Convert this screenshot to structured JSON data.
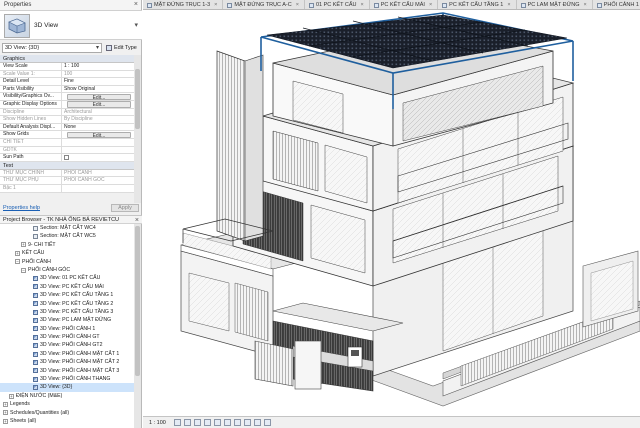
{
  "properties": {
    "title": "Properties",
    "type_selector": "3D View",
    "view_dropdown": "3D View: {3D}",
    "edit_type": "Edit Type",
    "sections": {
      "graphics": "Graphics",
      "text": "Text"
    },
    "graphics_rows": [
      {
        "key": "View Scale",
        "value": "1 : 100",
        "dim": false,
        "kind": "text"
      },
      {
        "key": "Scale Value    1:",
        "value": "100",
        "dim": true,
        "kind": "text"
      },
      {
        "key": "Detail Level",
        "value": "Fine",
        "dim": false,
        "kind": "text"
      },
      {
        "key": "Parts Visibility",
        "value": "Show Original",
        "dim": false,
        "kind": "text"
      },
      {
        "key": "Visibility/Graphics Ov...",
        "value": "Edit...",
        "dim": false,
        "kind": "button"
      },
      {
        "key": "Graphic Display Options",
        "value": "Edit...",
        "dim": false,
        "kind": "button"
      },
      {
        "key": "Discipline",
        "value": "Architectural",
        "dim": true,
        "kind": "text"
      },
      {
        "key": "Show Hidden Lines",
        "value": "By Discipline",
        "dim": true,
        "kind": "text"
      },
      {
        "key": "Default Analysis Displ...",
        "value": "None",
        "dim": false,
        "kind": "text"
      },
      {
        "key": "Show Grids",
        "value": "Edit...",
        "dim": false,
        "kind": "button"
      },
      {
        "key": "CHI TIẾT",
        "value": "",
        "dim": true,
        "kind": "text"
      },
      {
        "key": "GDTK",
        "value": "",
        "dim": true,
        "kind": "text"
      },
      {
        "key": "Sun Path",
        "value": "",
        "dim": false,
        "kind": "checkbox"
      }
    ],
    "text_rows": [
      {
        "key": "THƯ MỤC CHÍNH",
        "value": "PHỐI CẢNH",
        "dim": true
      },
      {
        "key": "THƯ MỤC PHỤ",
        "value": "PHỐI CẢNH GÓC",
        "dim": true
      },
      {
        "key": "Bậc 1",
        "value": "",
        "dim": true
      }
    ],
    "help_link": "Properties help",
    "apply": "Apply"
  },
  "project_browser": {
    "title": "Project Browser - TK NHÀ ỐNG BÁ REVIETCU",
    "items": [
      {
        "label": "Section: MẶT CẮT WC4",
        "indent": 5,
        "toggle": "",
        "icon": "view",
        "selected": false
      },
      {
        "label": "Section: MẶT CẮT WC5",
        "indent": 5,
        "toggle": "",
        "icon": "view",
        "selected": false
      },
      {
        "label": "9- CHI TIẾT",
        "indent": 3,
        "toggle": "+",
        "icon": "",
        "selected": false
      },
      {
        "label": "KẾT CẤU",
        "indent": 2,
        "toggle": "+",
        "icon": "",
        "selected": false
      },
      {
        "label": "PHỐI CẢNH",
        "indent": 2,
        "toggle": "−",
        "icon": "",
        "selected": false
      },
      {
        "label": "PHỐI CẢNH GÓC",
        "indent": 3,
        "toggle": "−",
        "icon": "",
        "selected": false
      },
      {
        "label": "3D View: 01 PC KẾT CẤU",
        "indent": 5,
        "toggle": "",
        "icon": "v3",
        "selected": false
      },
      {
        "label": "3D View: PC KẾT CẤU MÁI",
        "indent": 5,
        "toggle": "",
        "icon": "v3",
        "selected": false
      },
      {
        "label": "3D View: PC KẾT CẤU TẦNG 1",
        "indent": 5,
        "toggle": "",
        "icon": "v3",
        "selected": false
      },
      {
        "label": "3D View: PC KẾT CẤU TẦNG 2",
        "indent": 5,
        "toggle": "",
        "icon": "v3",
        "selected": false
      },
      {
        "label": "3D View: PC KẾT CẤU TẦNG 3",
        "indent": 5,
        "toggle": "",
        "icon": "v3",
        "selected": false
      },
      {
        "label": "3D View: PC LAM MẶT ĐỨNG",
        "indent": 5,
        "toggle": "",
        "icon": "v3",
        "selected": false
      },
      {
        "label": "3D View: PHỐI CẢNH 1",
        "indent": 5,
        "toggle": "",
        "icon": "v3",
        "selected": false
      },
      {
        "label": "3D View: PHỐI CẢNH GT",
        "indent": 5,
        "toggle": "",
        "icon": "v3",
        "selected": false
      },
      {
        "label": "3D View: PHỐI CẢNH GT2",
        "indent": 5,
        "toggle": "",
        "icon": "v3",
        "selected": false
      },
      {
        "label": "3D View: PHỐI CẢNH MẶT CẮT 1",
        "indent": 5,
        "toggle": "",
        "icon": "v3",
        "selected": false
      },
      {
        "label": "3D View: PHỐI CẢNH MẶT CẮT 2",
        "indent": 5,
        "toggle": "",
        "icon": "v3",
        "selected": false
      },
      {
        "label": "3D View: PHỐI CẢNH MẶT CẮT 3",
        "indent": 5,
        "toggle": "",
        "icon": "v3",
        "selected": false
      },
      {
        "label": "3D View: PHỐI CẢNH THANG",
        "indent": 5,
        "toggle": "",
        "icon": "v3",
        "selected": false
      },
      {
        "label": "3D View: {3D}",
        "indent": 5,
        "toggle": "",
        "icon": "v3",
        "selected": true
      },
      {
        "label": "ĐIỆN NƯỚC (M&E)",
        "indent": 1,
        "toggle": "+",
        "icon": "",
        "selected": false
      },
      {
        "label": "Legends",
        "indent": 0,
        "toggle": "+",
        "icon": "",
        "selected": false
      },
      {
        "label": "Schedules/Quantities (all)",
        "indent": 0,
        "toggle": "+",
        "icon": "",
        "selected": false
      },
      {
        "label": "Sheets (all)",
        "indent": 0,
        "toggle": "+",
        "icon": "",
        "selected": false
      }
    ]
  },
  "tabs": [
    {
      "label": "MẶT ĐỨNG TRỤC 1-3"
    },
    {
      "label": "MẶT ĐỨNG TRỤC A-C"
    },
    {
      "label": "01 PC KẾT CẤU"
    },
    {
      "label": "PC KẾT CẤU MÁI"
    },
    {
      "label": "PC KẾT CẤU TẦNG 1"
    },
    {
      "label": "PC LAM MẶT ĐỨNG"
    },
    {
      "label": "PHỐI CẢNH 1"
    }
  ],
  "status": {
    "scale": "1 : 100"
  },
  "colors": {
    "steel_blue": "#1f5f9e",
    "roof_dark": "#1a1f2a",
    "selected_row": "#cde3fb"
  },
  "icons": {
    "tab_icon": "3d-view-icon",
    "close": "close-icon"
  }
}
